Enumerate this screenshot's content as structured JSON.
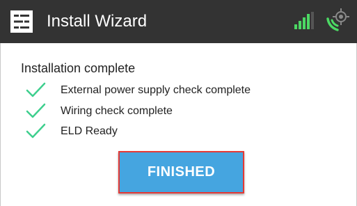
{
  "header": {
    "app_icon": "wizard-app-icon",
    "title": "Install Wizard",
    "signal_icon": "signal-strength-icon",
    "gps_icon": "gps-location-icon",
    "background_color": "#333333",
    "signal_color": "#4cd964"
  },
  "main": {
    "status_title": "Installation complete",
    "check_icon": "checkmark-icon",
    "check_color": "#3ecf8e",
    "checks": [
      {
        "label": "External power supply check complete"
      },
      {
        "label": "Wiring check complete"
      },
      {
        "label": "ELD Ready"
      }
    ],
    "finish_button": {
      "label": "FINISHED",
      "background_color": "#45a5e0",
      "border_color": "#e53935"
    }
  }
}
